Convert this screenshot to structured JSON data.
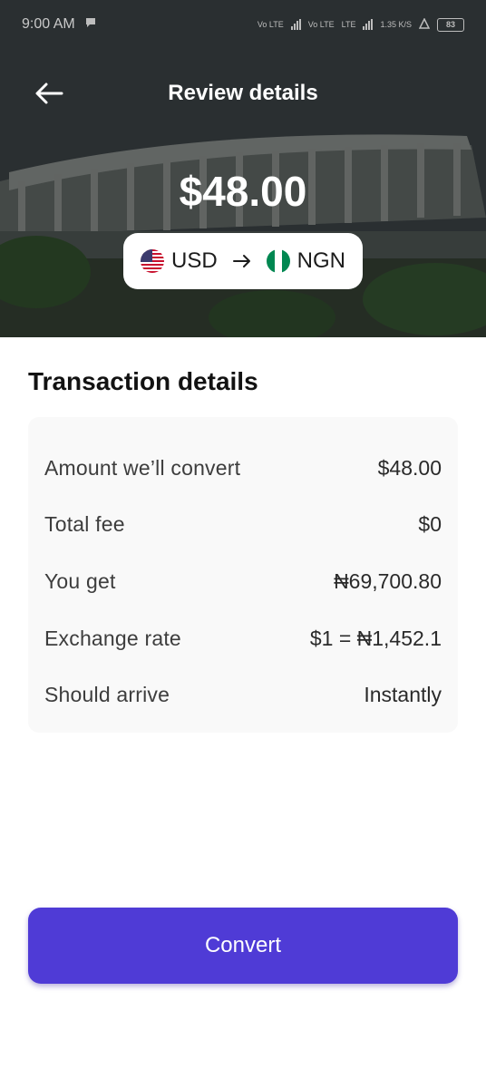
{
  "status_bar": {
    "time": "9:00 AM",
    "network_1": "Vo LTE",
    "network_2": "LTE",
    "network_3": "Vo LTE",
    "network_4": "LTE",
    "speed": "1.35 K/S",
    "battery": "83"
  },
  "header": {
    "title": "Review details",
    "back_icon": "arrow-left-icon"
  },
  "transfer": {
    "amount": "$48.00",
    "from_currency": "USD",
    "to_currency": "NGN",
    "from_flag": "us-flag-icon",
    "to_flag": "ng-flag-icon"
  },
  "details": {
    "title": "Transaction details",
    "rows": [
      {
        "label": "Amount we’ll convert",
        "value": "$48.00"
      },
      {
        "label": "Total fee",
        "value": "$0"
      },
      {
        "label": "You get",
        "value": "₦69,700.80"
      },
      {
        "label": "Exchange rate",
        "value": "$1 = ₦1,452.1"
      },
      {
        "label": "Should arrive",
        "value": "Instantly"
      }
    ]
  },
  "actions": {
    "convert_label": "Convert"
  },
  "colors": {
    "accent": "#4f3bd6",
    "card_bg": "#f9f9f9"
  }
}
